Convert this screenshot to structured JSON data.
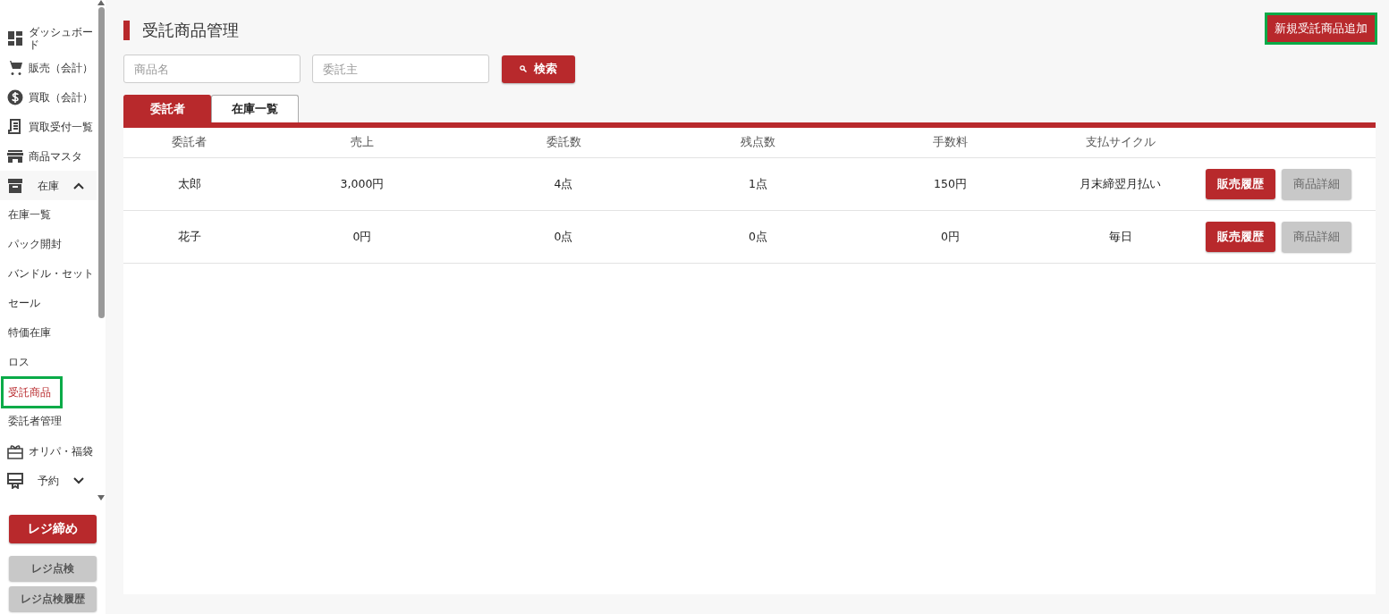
{
  "sidebar": {
    "items": [
      {
        "label": "ダッシュボード",
        "kind": "link"
      },
      {
        "label": "販売（会計）",
        "kind": "link"
      },
      {
        "label": "買取（会計）",
        "kind": "link"
      },
      {
        "label": "買取受付一覧",
        "kind": "link"
      },
      {
        "label": "商品マスタ",
        "kind": "link"
      },
      {
        "label": "在庫",
        "kind": "group",
        "expanded": true,
        "children": [
          {
            "label": "在庫一覧",
            "selected": false,
            "highlighted": false
          },
          {
            "label": "パック開封",
            "selected": false,
            "highlighted": false
          },
          {
            "label": "バンドル・セット",
            "selected": false,
            "highlighted": false
          },
          {
            "label": "セール",
            "selected": false,
            "highlighted": false
          },
          {
            "label": "特価在庫",
            "selected": false,
            "highlighted": false
          },
          {
            "label": "ロス",
            "selected": false,
            "highlighted": false
          },
          {
            "label": "受託商品",
            "selected": true,
            "highlighted": true
          },
          {
            "label": "委託者管理",
            "selected": false,
            "highlighted": false
          }
        ]
      },
      {
        "label": "オリパ・福袋",
        "kind": "link"
      },
      {
        "label": "予約",
        "kind": "group",
        "expanded": false
      }
    ],
    "buttons": [
      {
        "label": "レジ締め",
        "kind": "primary"
      },
      {
        "label": "レジ点検",
        "kind": "secondary"
      },
      {
        "label": "レジ点検履歴",
        "kind": "secondary"
      }
    ]
  },
  "main": {
    "title": "受託商品管理",
    "add_button": {
      "label": "新規受託商品追加",
      "highlighted": true
    },
    "search": {
      "fields": [
        {
          "placeholder": "商品名"
        },
        {
          "placeholder": "委託主"
        }
      ],
      "button": "検索"
    },
    "tabs": [
      {
        "label": "委託者",
        "selected": true
      },
      {
        "label": "在庫一覧",
        "selected": false
      }
    ],
    "table": {
      "columns": [
        "委託者",
        "売上",
        "委託数",
        "残点数",
        "手数料",
        "支払サイクル"
      ],
      "rows": [
        {
          "cells": [
            "太郎",
            "3,000円",
            "4点",
            "1点",
            "150円",
            "月末締翌月払い"
          ],
          "actions": [
            {
              "label": "販売履歴",
              "kind": "primary"
            },
            {
              "label": "商品詳細",
              "kind": "secondary"
            }
          ]
        },
        {
          "cells": [
            "花子",
            "0円",
            "0点",
            "0点",
            "0円",
            "毎日"
          ],
          "actions": [
            {
              "label": "販売履歴",
              "kind": "primary"
            },
            {
              "label": "商品詳細",
              "kind": "secondary"
            }
          ]
        }
      ]
    }
  }
}
